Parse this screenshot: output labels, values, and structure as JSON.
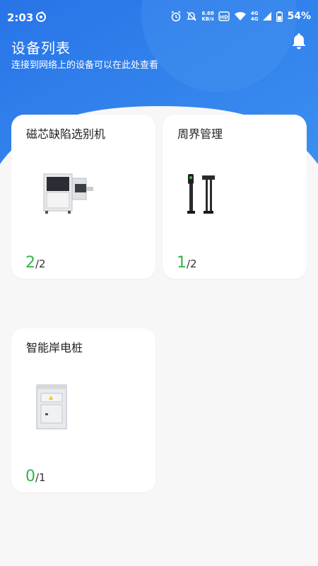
{
  "status_bar": {
    "time": "2:03",
    "net_speed_value": "6.68",
    "net_speed_unit": "KB/s",
    "signal_label_top": "4G",
    "signal_label_bottom": "4G",
    "battery": "54%"
  },
  "header": {
    "title": "设备列表",
    "subtitle": "连接到网络上的设备可以在此处查看"
  },
  "devices": [
    {
      "name": "磁芯缺陷选别机",
      "online": "2",
      "total": "/2",
      "icon": "sorting-machine"
    },
    {
      "name": "周界管理",
      "online": "1",
      "total": "/2",
      "icon": "gate-barrier"
    },
    {
      "name": "智能岸电桩",
      "online": "0",
      "total": "/1",
      "icon": "power-cabinet"
    }
  ],
  "colors": {
    "header_blue": "#2f80ed",
    "online_green": "#2db84c",
    "background": "#f7f7f8"
  }
}
